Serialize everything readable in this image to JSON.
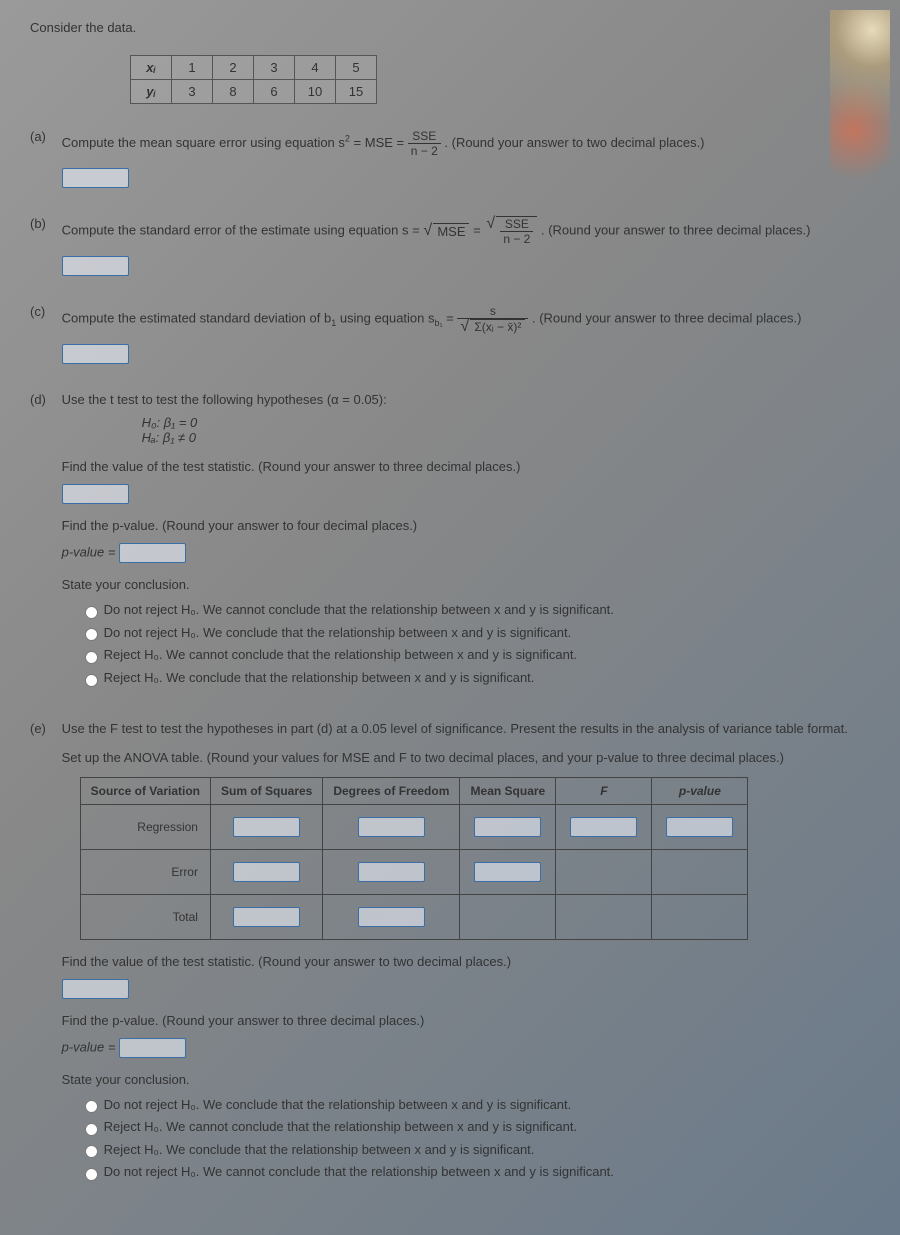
{
  "intro": "Consider the data.",
  "dataTable": {
    "xLabel": "xᵢ",
    "yLabel": "yᵢ",
    "x": [
      "1",
      "2",
      "3",
      "4",
      "5"
    ],
    "y": [
      "3",
      "8",
      "6",
      "10",
      "15"
    ]
  },
  "a": {
    "label": "(a)",
    "text1": "Compute the mean square error using equation s",
    "text2": " = MSE = ",
    "fracNum": "SSE",
    "fracDen": "n − 2",
    "round": ". (Round your answer to two decimal places.)"
  },
  "b": {
    "label": "(b)",
    "text1": "Compute the standard error of the estimate using equation s = ",
    "sqrtMSE": "MSE",
    "eq": " = ",
    "fracNum": "SSE",
    "fracDen": "n − 2",
    "round": ". (Round your answer to three decimal places.)"
  },
  "c": {
    "label": "(c)",
    "text1": "Compute the estimated standard deviation of b",
    "text2": " using equation s",
    "sub": "b₁",
    "eq": " = ",
    "fracNum": "s",
    "fracDen": "Σ(xᵢ − x̄)²",
    "round": ". (Round your answer to three decimal places.)"
  },
  "d": {
    "label": "(d)",
    "text1": "Use the t test to test the following hypotheses (α = 0.05):",
    "h0": "H₀: β₁ = 0",
    "ha": "Hₐ: β₁ ≠ 0",
    "find1": "Find the value of the test statistic. (Round your answer to three decimal places.)",
    "find2": "Find the p-value. (Round your answer to four decimal places.)",
    "pvalLabel": "p-value = ",
    "state": "State your conclusion.",
    "opt1pre": "Do not reject H₀. ",
    "opt1": "We cannot conclude that the relationship between x and y is significant.",
    "opt2pre": "Do not reject H₀. ",
    "opt2": "We conclude that the relationship between x and y is significant.",
    "opt3pre": "Reject H₀. ",
    "opt3": "We cannot conclude that the relationship between x and y is significant.",
    "opt4pre": "Reject H₀. ",
    "opt4": "We conclude that the relationship between x and y is significant."
  },
  "e": {
    "label": "(e)",
    "text1": "Use the F test to test the hypotheses in part (d) at a 0.05 level of significance. Present the results in the analysis of variance table format.",
    "setup": "Set up the ANOVA table. (Round your values for MSE and F to two decimal places, and your p-value to three decimal places.)",
    "headers": {
      "src": "Source of Variation",
      "ss": "Sum of Squares",
      "df": "Degrees of Freedom",
      "ms": "Mean Square",
      "f": "F",
      "p": "p-value"
    },
    "rows": {
      "reg": "Regression",
      "err": "Error",
      "tot": "Total"
    },
    "find1": "Find the value of the test statistic. (Round your answer to two decimal places.)",
    "find2": "Find the p-value. (Round your answer to three decimal places.)",
    "pvalLabel": "p-value = ",
    "state": "State your conclusion.",
    "opt1pre": "Do not reject H₀. ",
    "opt1": "We conclude that the relationship between x and y is significant.",
    "opt2pre": "Reject H₀. ",
    "opt2": "We cannot conclude that the relationship between x and y is significant.",
    "opt3pre": "Reject H₀. ",
    "opt3": "We conclude that the relationship between x and y is significant.",
    "opt4pre": "Do not reject H₀. ",
    "opt4": "We cannot conclude that the relationship between x and y is significant."
  }
}
